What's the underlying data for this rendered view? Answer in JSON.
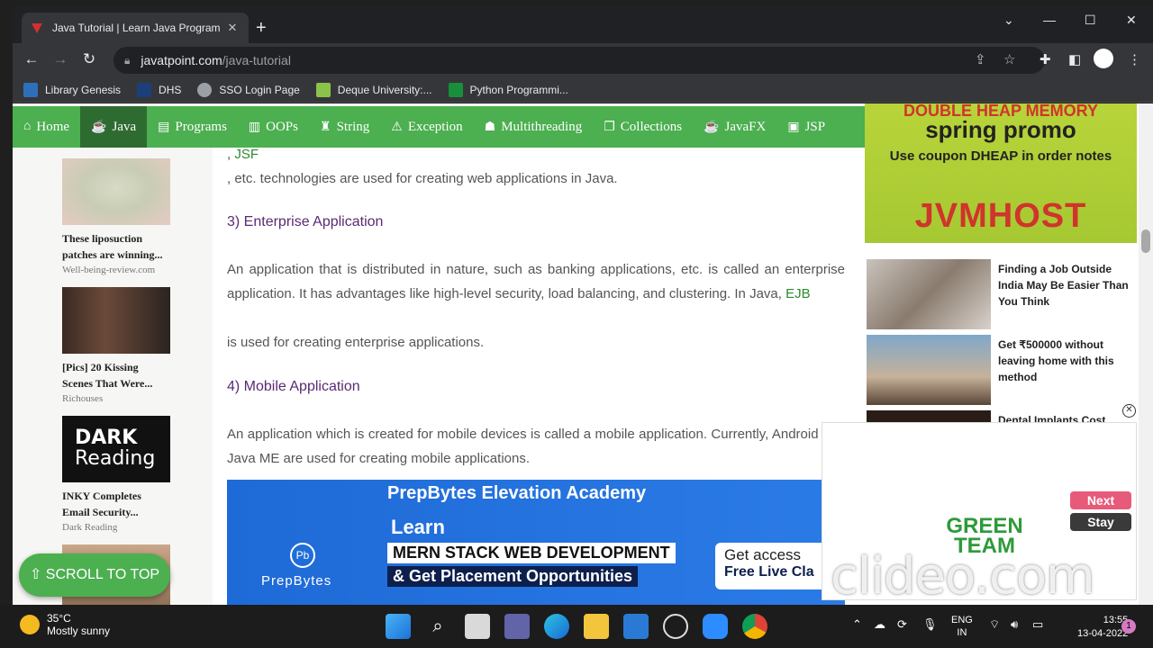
{
  "browser": {
    "tab_title": "Java Tutorial | Learn Java Program",
    "url_host": "javatpoint.com",
    "url_path": "/java-tutorial"
  },
  "bookmarks": [
    {
      "label": "Library Genesis",
      "icon": "library-icon",
      "color": "#2e6fba"
    },
    {
      "label": "DHS",
      "icon": "dhs-icon",
      "color": "#1a3f7a"
    },
    {
      "label": "SSO Login Page",
      "icon": "globe-icon",
      "color": "#9aa0a6"
    },
    {
      "label": "Deque University:...",
      "icon": "deque-icon",
      "color": "#8bc34a"
    },
    {
      "label": "Python Programmi...",
      "icon": "python-icon",
      "color": "#1a8f3a"
    }
  ],
  "nav": [
    {
      "label": "Home",
      "icon": "⌂"
    },
    {
      "label": "Java",
      "icon": "☕"
    },
    {
      "label": "Programs",
      "icon": "▤"
    },
    {
      "label": "OOPs",
      "icon": "▥"
    },
    {
      "label": "String",
      "icon": "♜"
    },
    {
      "label": "Exception",
      "icon": "⚠"
    },
    {
      "label": "Multithreading",
      "icon": "☗"
    },
    {
      "label": "Collections",
      "icon": "❐"
    },
    {
      "label": "JavaFX",
      "icon": "☕"
    },
    {
      "label": "JSP",
      "icon": "▣"
    }
  ],
  "left_ads": [
    {
      "title": "These liposuction patches are winning...",
      "source": "Well-being-review.com"
    },
    {
      "title": "[Pics] 20 Kissing Scenes That Were...",
      "source": "Richouses"
    },
    {
      "title": "INKY Completes Email Security...",
      "source": "Dark Reading",
      "logo_l1": "DARK",
      "logo_l2": "Reading"
    }
  ],
  "content": {
    "jsf_link": "JSF",
    "jsf_prefix": ", ",
    "p1": ", etc. technologies are used for creating web applications in Java.",
    "h_enterprise": "3) Enterprise Application",
    "p2": "An application that is distributed in nature, such as banking applications, etc. is called an enterprise application. It has advantages like high-level security, load balancing, and clustering. In Java,",
    "ejb_link": "EJB",
    "p3": "is used for creating enterprise applications.",
    "h_mobile": "4) Mobile Application",
    "p4": "An application which is created for mobile devices is called a mobile application. Currently, Android and Java ME are used for creating mobile applications."
  },
  "banner": {
    "title": "PrepBytes Elevation Academy",
    "learn": "Learn",
    "line1": "MERN STACK WEB DEVELOPMENT",
    "line2": "& Get Placement Opportunities",
    "brand": "PrepBytes",
    "cta1": "Get access",
    "cta2": "Free Live Cla"
  },
  "promo": {
    "l1": "DOUBLE HEAP MEMORY",
    "l2": "spring promo",
    "l3": "Use coupon DHEAP in order notes",
    "l4": "JVMHOST"
  },
  "right_ads": [
    {
      "text": "Finding a Job Outside India May Be Easier Than You Think"
    },
    {
      "text": "Get ₹500000 without leaving home with this method"
    },
    {
      "text": "Dental Implants Cost"
    }
  ],
  "video": {
    "next": "Next",
    "stay": "Stay",
    "logo": "GREEN TEAM"
  },
  "scroll_top": "⇧ SCROLL TO TOP",
  "watermark": "clideo.com",
  "taskbar": {
    "temp": "35°C",
    "weather": "Mostly sunny",
    "lang1": "ENG",
    "lang2": "IN",
    "time": "13:55",
    "date": "13-04-2022",
    "notifications": "1"
  }
}
